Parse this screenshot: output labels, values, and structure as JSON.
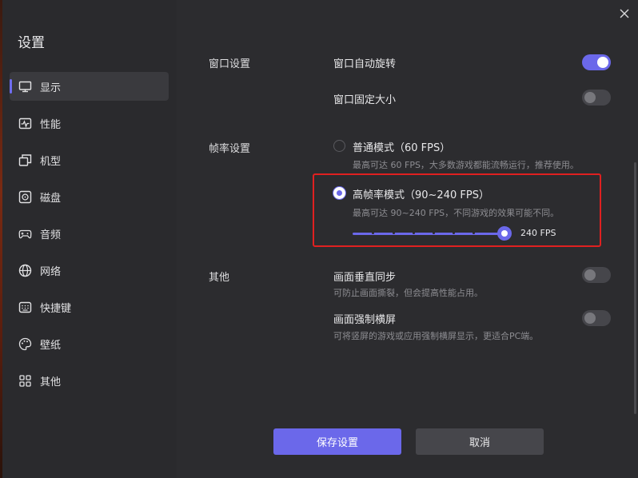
{
  "sidebar": {
    "title": "设置",
    "items": [
      {
        "label": "显示",
        "icon": "monitor-icon",
        "active": true
      },
      {
        "label": "性能",
        "icon": "performance-icon"
      },
      {
        "label": "机型",
        "icon": "device-model-icon"
      },
      {
        "label": "磁盘",
        "icon": "disk-icon"
      },
      {
        "label": "音频",
        "icon": "gamepad-icon"
      },
      {
        "label": "网络",
        "icon": "globe-icon"
      },
      {
        "label": "快捷键",
        "icon": "keyboard-icon"
      },
      {
        "label": "壁纸",
        "icon": "palette-icon"
      },
      {
        "label": "其他",
        "icon": "grid-icon"
      }
    ]
  },
  "window": {
    "close_icon": "close-icon"
  },
  "sections": {
    "window": {
      "label": "窗口设置",
      "auto_rotate": {
        "label": "窗口自动旋转",
        "enabled": true
      },
      "fixed_size": {
        "label": "窗口固定大小",
        "enabled": false
      }
    },
    "framerate": {
      "label": "帧率设置",
      "normal": {
        "label": "普通模式（60 FPS）",
        "desc": "最高可达 60 FPS，大多数游戏都能流畅运行，推荐使用。",
        "selected": false
      },
      "high": {
        "label": "高帧率模式（90~240 FPS）",
        "desc": "最高可达 90~240 FPS，不同游戏的效果可能不同。",
        "selected": true
      },
      "slider": {
        "min": 90,
        "max": 240,
        "value": 240,
        "value_label": "240 FPS"
      }
    },
    "other": {
      "label": "其他",
      "vsync": {
        "label": "画面垂直同步",
        "desc": "可防止画面撕裂，但会提高性能占用。",
        "enabled": false
      },
      "force_landscape": {
        "label": "画面强制横屏",
        "desc": "可将竖屏的游戏或应用强制横屏显示，更适合PC端。",
        "enabled": false
      }
    }
  },
  "footer": {
    "save_label": "保存设置",
    "cancel_label": "取消"
  },
  "colors": {
    "accent": "#6b68ea",
    "highlight_border": "#e02020",
    "sidebar_bg": "#2a2a2d",
    "content_bg": "#2c2c2f"
  }
}
